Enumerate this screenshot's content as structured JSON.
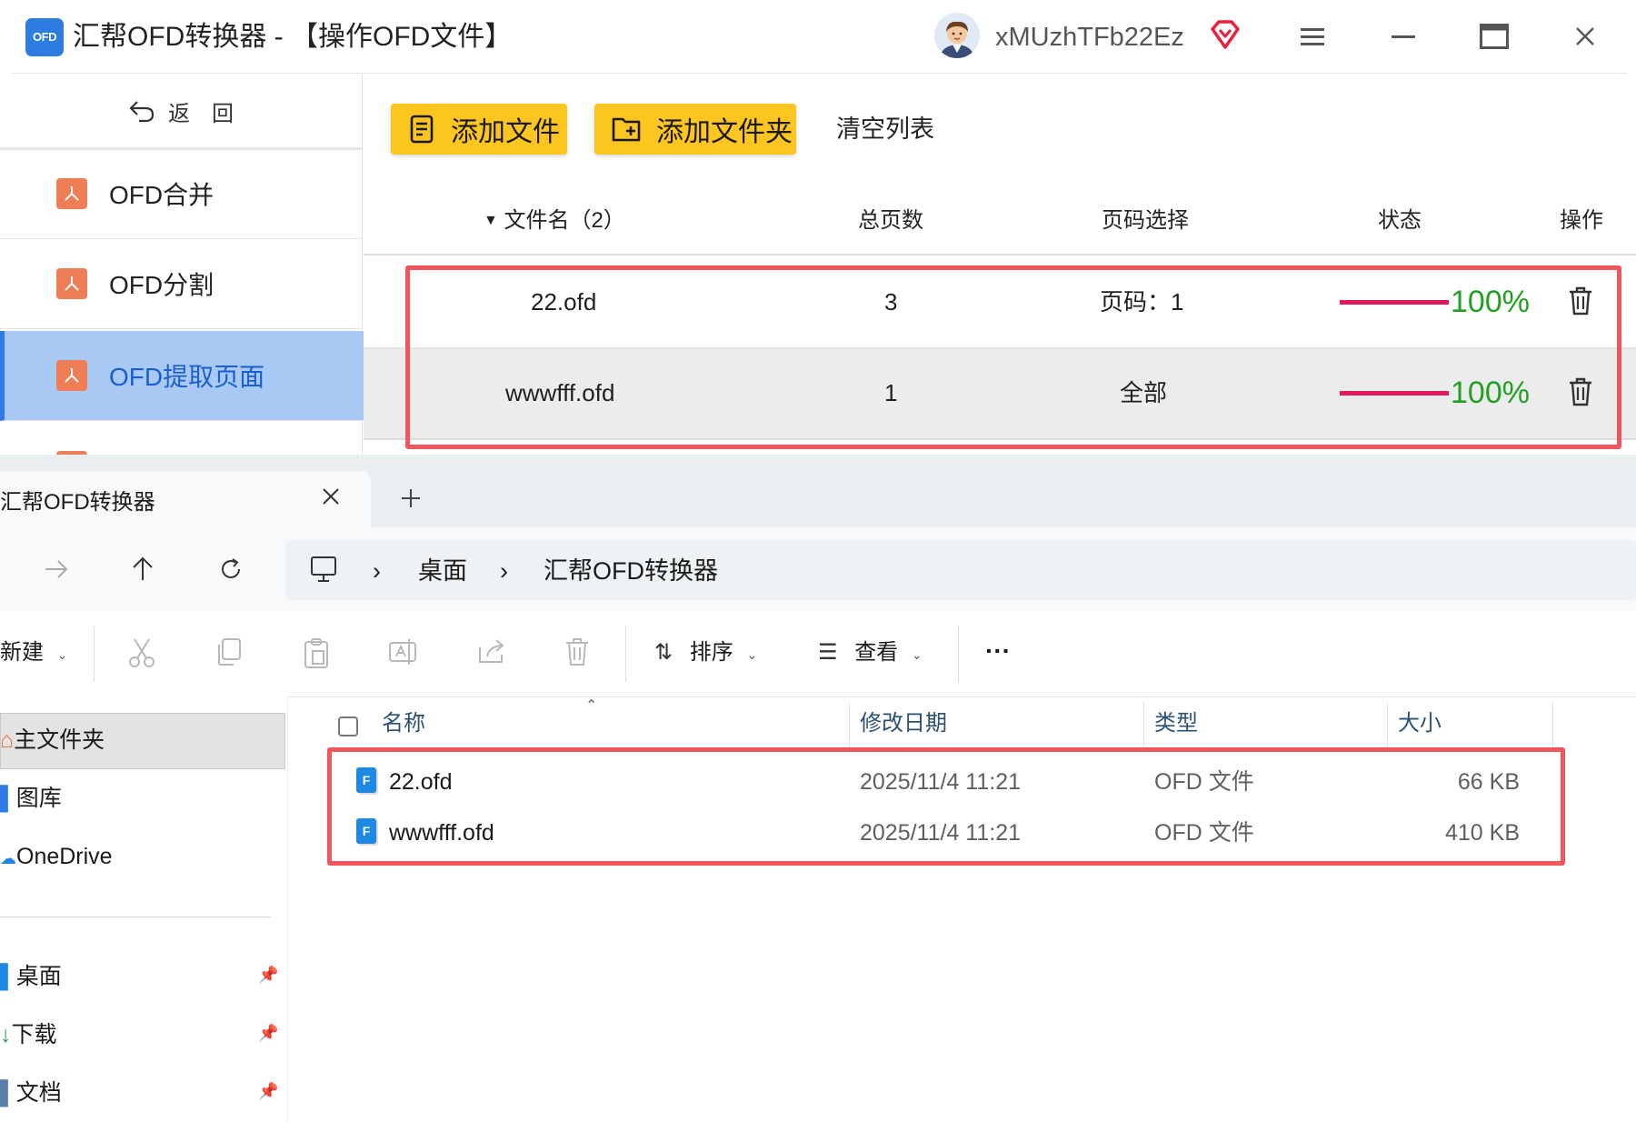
{
  "app": {
    "logo_text": "OFD",
    "title": "汇帮OFD转换器 - 【操作OFD文件】",
    "username": "xMUzhTFb22Ez",
    "sidebar": {
      "back_label": "返　回",
      "items": [
        {
          "label": "OFD合并"
        },
        {
          "label": "OFD分割"
        },
        {
          "label": "OFD提取页面"
        }
      ]
    },
    "toolbar": {
      "add_file": "添加文件",
      "add_folder": "添加文件夹",
      "clear_list": "清空列表"
    },
    "table": {
      "headers": {
        "filename": "文件名（2）",
        "total_pages": "总页数",
        "page_select": "页码选择",
        "status": "状态",
        "action": "操作"
      },
      "rows": [
        {
          "name": "22.ofd",
          "pages": "3",
          "selection": "页码：1",
          "progress": 1.0,
          "percent": "100%"
        },
        {
          "name": "wwwfff.ofd",
          "pages": "1",
          "selection": "全部",
          "progress": 1.0,
          "percent": "100%"
        }
      ]
    },
    "colors": {
      "accent_yellow": "#fcc520",
      "active_blue": "#a9c9f5",
      "progress_bar": "#e3195a",
      "percent_green": "#21a021",
      "highlight_red": "#f2555c"
    }
  },
  "explorer": {
    "tab_title": "汇帮OFD转换器",
    "breadcrumb": [
      "桌面",
      "汇帮OFD转换器"
    ],
    "toolbar": {
      "new_label": "新建",
      "sort_label": "排序",
      "view_label": "查看",
      "more_label": "···"
    },
    "nav": {
      "home": "主文件夹",
      "gallery": "图库",
      "onedrive": "OneDrive",
      "desktop": "桌面",
      "downloads": "下载",
      "documents": "文档"
    },
    "columns": {
      "name": "名称",
      "modified": "修改日期",
      "type": "类型",
      "size": "大小"
    },
    "files": [
      {
        "name": "22.ofd",
        "modified": "2025/11/4 11:21",
        "type": "OFD 文件",
        "size": "66 KB"
      },
      {
        "name": "wwwfff.ofd",
        "modified": "2025/11/4 11:21",
        "type": "OFD 文件",
        "size": "410 KB"
      }
    ]
  }
}
